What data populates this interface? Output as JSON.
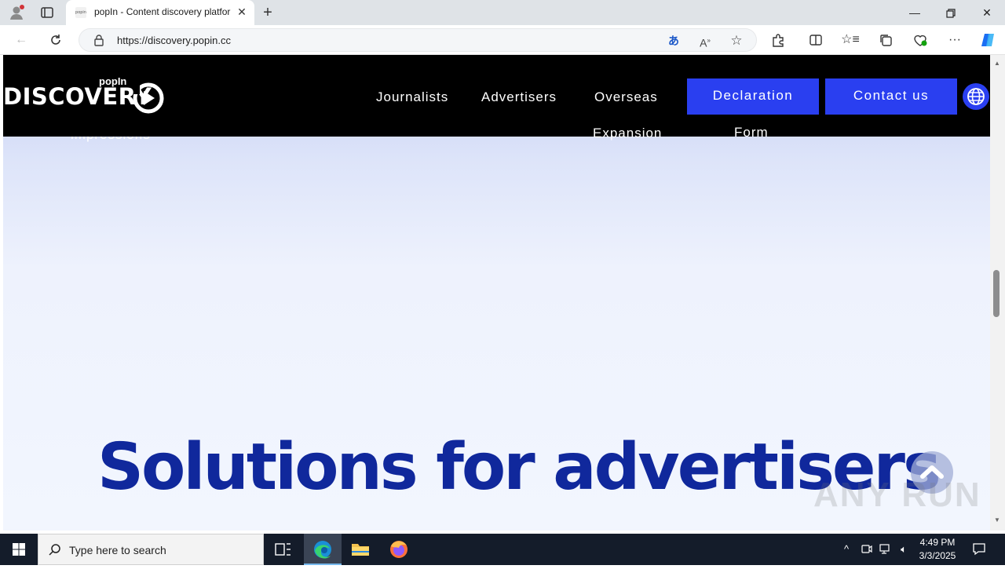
{
  "browser": {
    "tab_title": "popIn - Content discovery platfor",
    "favicon_text": "popin",
    "url": "https://discovery.popin.cc"
  },
  "site": {
    "logo_small": "popIn",
    "logo_big": "DISCOVERY",
    "nav": [
      "Journalists",
      "Advertisers",
      "Overseas",
      "Expansion"
    ],
    "declaration_button": "Declaration",
    "declaration_overflow": "Form",
    "contact_button": "Contact us",
    "behind_text": "impressions",
    "headline": "Solutions for advertisers"
  },
  "watermark": "ANY RUN",
  "taskbar": {
    "search_placeholder": "Type here to search",
    "time": "4:49 PM",
    "date": "3/3/2025"
  },
  "colors": {
    "accent_blue": "#2a3ff0",
    "headline_blue": "#10289c"
  },
  "icons": [
    "profile-icon",
    "tab-actions-icon",
    "new-tab-icon",
    "back-icon",
    "refresh-icon",
    "lock-icon",
    "translate-icon",
    "read-aloud-icon",
    "favorite-icon",
    "extensions-icon",
    "split-screen-icon",
    "favorites-icon",
    "collections-icon",
    "browser-essentials-icon",
    "more-icon",
    "copilot-icon",
    "globe-icon",
    "chevron-up-icon",
    "windows-start-icon",
    "search-icon",
    "task-view-icon",
    "edge-icon",
    "file-explorer-icon",
    "firefox-icon",
    "notifications-icon"
  ]
}
